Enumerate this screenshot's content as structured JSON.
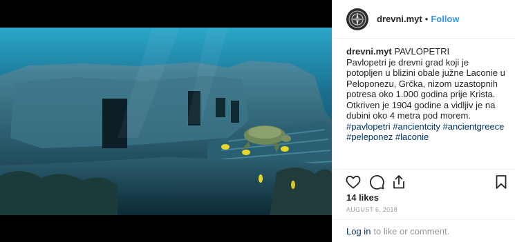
{
  "post": {
    "username": "drevni.myt",
    "separator": "•",
    "follow_label": "Follow",
    "caption": {
      "username": "drevni.myt",
      "title": "PAVLOPETRI",
      "body": "Pavlopetri je drevni grad koji je potopljen u blizini obale južne Laconie u Peloponezu, Grčka, nizom uzastopnih potresa oko 1.000 godina prije Krista. Otkriven je 1904 godine a vidljiv je na dubini oko 4 metra pod morem.",
      "hashtags": [
        "#pavlopetri",
        "#ancientcity",
        "#ancientgreece",
        "#peleponez",
        "#laconie"
      ]
    },
    "likes": "14 likes",
    "date": "AUGUST 6, 2018",
    "comment": {
      "login_label": "Log in",
      "suffix": "to like or comment."
    }
  },
  "icons": {
    "avatar": "compass-logo-icon",
    "like": "heart-icon",
    "comment": "comment-bubble-icon",
    "share": "share-icon",
    "save": "bookmark-icon"
  },
  "colors": {
    "link": "#3897f0",
    "hashtag": "#003569",
    "muted": "#999999",
    "text": "#262626"
  }
}
